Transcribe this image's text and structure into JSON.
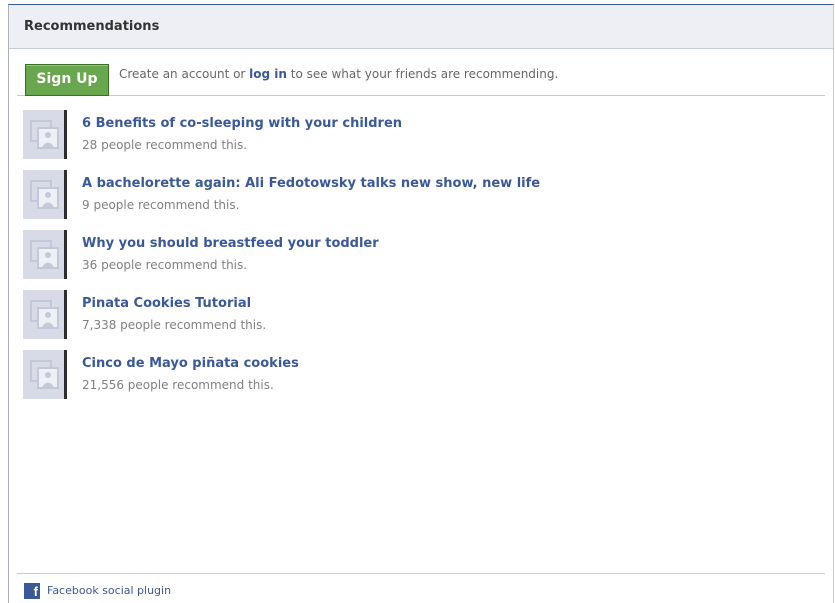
{
  "header": {
    "title": "Recommendations"
  },
  "signup": {
    "button_label": "Sign Up",
    "text_before": "Create an account or ",
    "login_link": "log in",
    "text_after": " to see what your friends are recommending."
  },
  "items": [
    {
      "title": "6 Benefits of co-sleeping with your children",
      "count_text": "28 people recommend this."
    },
    {
      "title": "A bachelorette again: Ali Fedotowsky talks new show, new life",
      "count_text": "9 people recommend this."
    },
    {
      "title": "Why you should breastfeed your toddler",
      "count_text": "36 people recommend this."
    },
    {
      "title": "Pinata Cookies Tutorial",
      "count_text": "7,338 people recommend this."
    },
    {
      "title": "Cinco de Mayo piñata cookies",
      "count_text": "21,556 people recommend this."
    }
  ],
  "footer": {
    "text": "Facebook social plugin",
    "icon": "facebook-icon"
  },
  "colors": {
    "link": "#3b5998",
    "signup_green": "#69a74e",
    "header_bg": "#edeff4"
  }
}
